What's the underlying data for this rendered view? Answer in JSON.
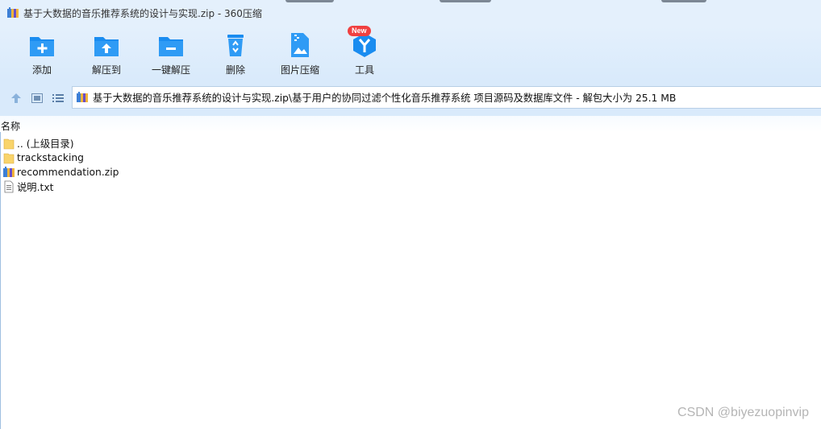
{
  "window": {
    "title": "基于大数据的音乐推荐系统的设计与实现.zip - 360压缩"
  },
  "toolbar": {
    "items": [
      {
        "label": "添加",
        "icon": "folder-plus-icon"
      },
      {
        "label": "解压到",
        "icon": "folder-extract-icon"
      },
      {
        "label": "一键解压",
        "icon": "folder-minus-icon"
      },
      {
        "label": "删除",
        "icon": "recycle-bin-icon"
      },
      {
        "label": "图片压缩",
        "icon": "image-compress-icon"
      },
      {
        "label": "工具",
        "icon": "tools-icon",
        "badge": "New"
      }
    ]
  },
  "navigation": {
    "up_icon": "arrow-up-icon",
    "view_thumbnail_icon": "thumbnail-view-icon",
    "view_list_icon": "list-view-icon",
    "address_path": "基于大数据的音乐推荐系统的设计与实现.zip\\基于用户的协同过滤个性化音乐推荐系统 项目源码及数据库文件 - 解包大小为 25.1 MB"
  },
  "file_list": {
    "column_name": "名称",
    "items": [
      {
        "name": ".. (上级目录)",
        "type": "parent-folder"
      },
      {
        "name": "trackstacking",
        "type": "folder"
      },
      {
        "name": "recommendation.zip",
        "type": "zip"
      },
      {
        "name": "说明.txt",
        "type": "text"
      }
    ]
  },
  "watermark": "CSDN @biyezuopinvip",
  "colors": {
    "toolbar_bg": "#e4f0fc",
    "icon_blue": "#1a8cf0",
    "badge_red": "#f04040",
    "folder_yellow": "#f9d46b"
  }
}
